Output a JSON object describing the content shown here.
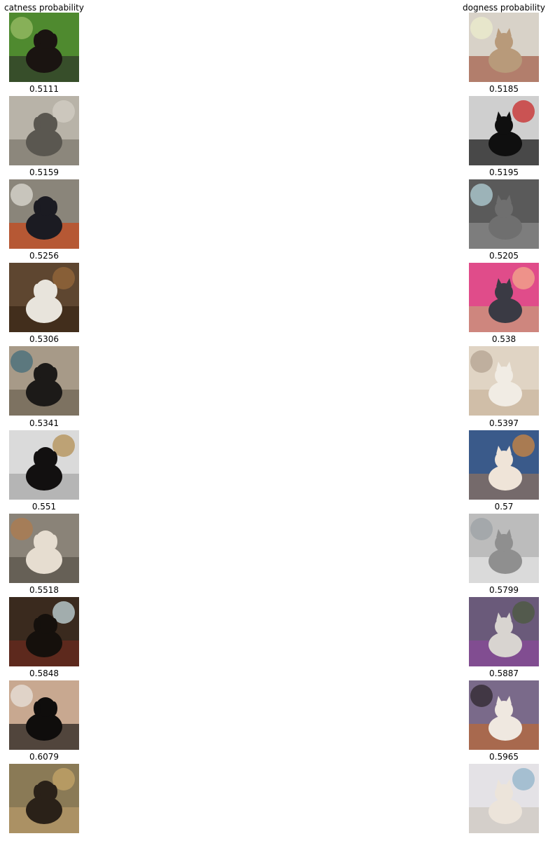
{
  "columns": [
    {
      "title": "catness probability",
      "rows": [
        {
          "label": "",
          "subject": "dog-photo-icon",
          "bg": "#4f8a2f",
          "mid": "#2f3a2a",
          "fg": "#1a1411",
          "accent": "#9fc06a"
        },
        {
          "label": "0.5111",
          "subject": "dog-photo-icon",
          "bg": "#b8b3a8",
          "mid": "#7e786d",
          "fg": "#5a5750",
          "accent": "#d4d0c6"
        },
        {
          "label": "0.5159",
          "subject": "dog-photo-icon",
          "bg": "#8a857a",
          "mid": "#c44a1e",
          "fg": "#1b1b22",
          "accent": "#e3e0d8"
        },
        {
          "label": "0.5256",
          "subject": "dog-photo-icon",
          "bg": "#5e4630",
          "mid": "#3a2716",
          "fg": "#e8e4dc",
          "accent": "#9a6a3a"
        },
        {
          "label": "0.5306",
          "subject": "dog-photo-icon",
          "bg": "#a79a88",
          "mid": "#6f6454",
          "fg": "#1c1a18",
          "accent": "#3c6a7a"
        },
        {
          "label": "0.5341",
          "subject": "dog-photo-icon",
          "bg": "#dadada",
          "mid": "#a8a8a8",
          "fg": "#121010",
          "accent": "#b08a4a"
        },
        {
          "label": "0.551",
          "subject": "dog-photo-icon",
          "bg": "#8a8378",
          "mid": "#5a544b",
          "fg": "#e6ddd0",
          "accent": "#b07a4a"
        },
        {
          "label": "0.5518",
          "subject": "dog-photo-icon",
          "bg": "#3a2a1e",
          "mid": "#6a2a1e",
          "fg": "#15100c",
          "accent": "#cfe6ea"
        },
        {
          "label": "0.5848",
          "subject": "dog-photo-icon",
          "bg": "#c8a890",
          "mid": "#2a2420",
          "fg": "#0f0d0c",
          "accent": "#e9e6e0"
        },
        {
          "label": "0.6079",
          "subject": "dog-photo-icon",
          "bg": "#8a7a56",
          "mid": "#b59a6a",
          "fg": "#2a2118",
          "accent": "#c9a86a"
        }
      ]
    },
    {
      "title": "dogness probability",
      "rows": [
        {
          "label": "",
          "subject": "cat-photo-icon",
          "bg": "#d8d2c8",
          "mid": "#a6624e",
          "fg": "#b89a7a",
          "accent": "#eeeecc"
        },
        {
          "label": "0.5185",
          "subject": "cat-photo-icon",
          "bg": "#cfcfcf",
          "mid": "#1b1b1b",
          "fg": "#0f0f0f",
          "accent": "#c81e1e"
        },
        {
          "label": "0.5195",
          "subject": "cat-photo-icon",
          "bg": "#5a5a5a",
          "mid": "#8a8a8a",
          "fg": "#6f6f6f",
          "accent": "#b8d8e0"
        },
        {
          "label": "0.5205",
          "subject": "cat-photo-icon",
          "bg": "#e04c8a",
          "mid": "#c89a7a",
          "fg": "#3a3a44",
          "accent": "#f3b08a"
        },
        {
          "label": "0.538",
          "subject": "cat-photo-icon",
          "bg": "#e0d4c4",
          "mid": "#cbb79f",
          "fg": "#f1ece4",
          "accent": "#b0a08e"
        },
        {
          "label": "0.5397",
          "subject": "cat-photo-icon",
          "bg": "#3a5a8a",
          "mid": "#8a7060",
          "fg": "#efe4d8",
          "accent": "#d8893a"
        },
        {
          "label": "0.57",
          "subject": "cat-photo-icon",
          "bg": "#bcbcbc",
          "mid": "#e4e4e4",
          "fg": "#8f8f8f",
          "accent": "#9aa0a4"
        },
        {
          "label": "0.5799",
          "subject": "cat-photo-icon",
          "bg": "#6a5a7a",
          "mid": "#8a4a9a",
          "fg": "#d8d4d0",
          "accent": "#4a5a3a"
        },
        {
          "label": "0.5887",
          "subject": "cat-photo-icon",
          "bg": "#7a6a8a",
          "mid": "#b86a3a",
          "fg": "#efe8e0",
          "accent": "#2a2226"
        },
        {
          "label": "0.5965",
          "subject": "cat-photo-icon",
          "bg": "#e4e2e6",
          "mid": "#cfc8c0",
          "fg": "#ece4da",
          "accent": "#8ab0c8"
        }
      ]
    }
  ]
}
